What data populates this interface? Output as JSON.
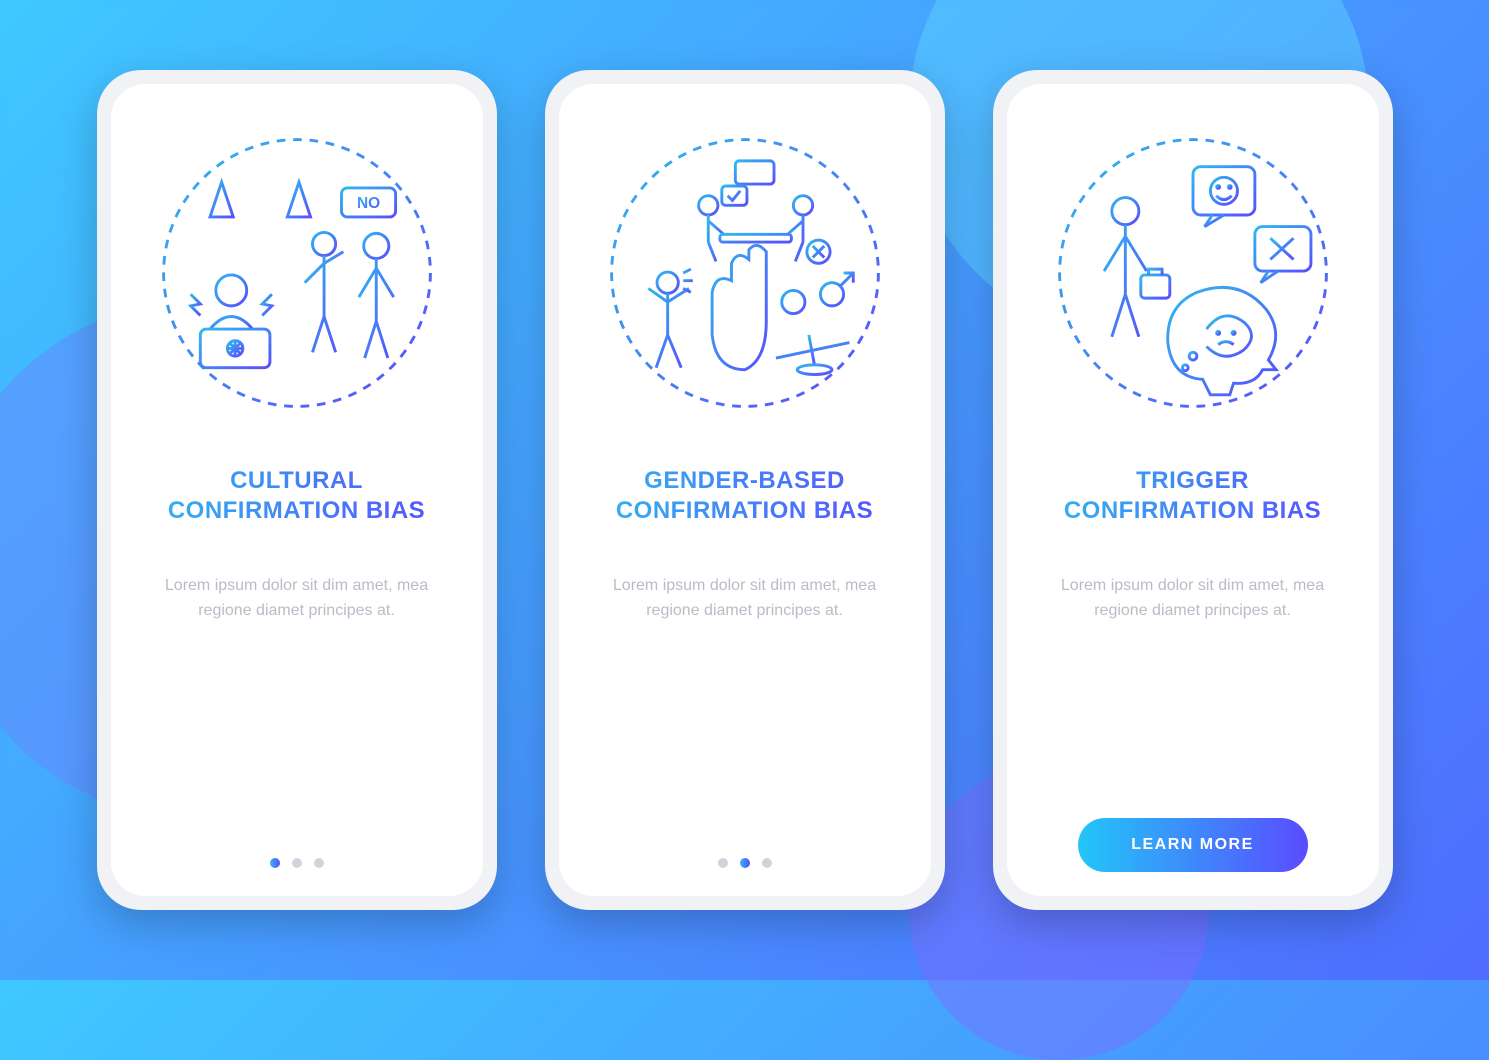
{
  "cards": [
    {
      "title": "CULTURAL CONFIRMATION BIAS",
      "description": "Lorem ipsum dolor sit dim amet, mea regione diamet principes at.",
      "pager_active_index": 0,
      "has_button": false
    },
    {
      "title": "GENDER-BASED CONFIRMATION BIAS",
      "description": "Lorem ipsum dolor sit dim amet, mea regione diamet principes at.",
      "pager_active_index": 1,
      "has_button": false
    },
    {
      "title": "TRIGGER CONFIRMATION BIAS",
      "description": "Lorem ipsum dolor sit dim amet, mea regione diamet principes at.",
      "pager_active_index": 2,
      "has_button": true
    }
  ],
  "button_label": "LEARN MORE",
  "illustration_text": {
    "no_badge": "NO"
  },
  "colors": {
    "grad_start": "#2fb9ee",
    "grad_end": "#5a4cff",
    "desc": "#b7bcc6"
  }
}
